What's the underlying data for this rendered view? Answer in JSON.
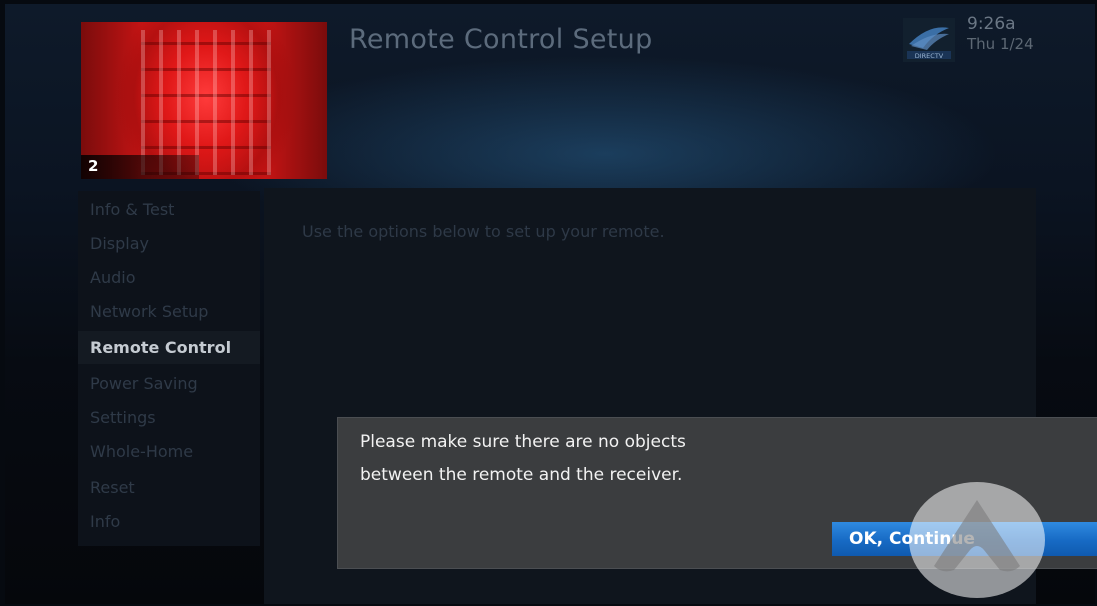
{
  "header": {
    "title": "Remote Control Setup",
    "time": "9:26a",
    "date": "Thu 1/24",
    "logo_text": "DIRECTV"
  },
  "preview": {
    "channel": "2"
  },
  "menu": {
    "items": [
      {
        "label": "Info & Test"
      },
      {
        "label": "Display"
      },
      {
        "label": "Audio"
      },
      {
        "label": "Network Setup"
      },
      {
        "label": "Remote Control"
      },
      {
        "label": "Power Saving"
      },
      {
        "label": "Settings"
      },
      {
        "label": "Whole-Home"
      },
      {
        "label": "Reset"
      },
      {
        "label": "Info"
      }
    ],
    "selected": "Remote Control"
  },
  "content": {
    "instruction": "Use the options below to set up your remote."
  },
  "dialog": {
    "line1": "Please make sure there are no objects",
    "line2": "between the remote and the receiver.",
    "ok_label": "OK, Continue"
  },
  "colors": {
    "accent": "#1f78d1",
    "dialog_bg": "#3b3d3f",
    "selected_text": "#c5cbd2"
  }
}
